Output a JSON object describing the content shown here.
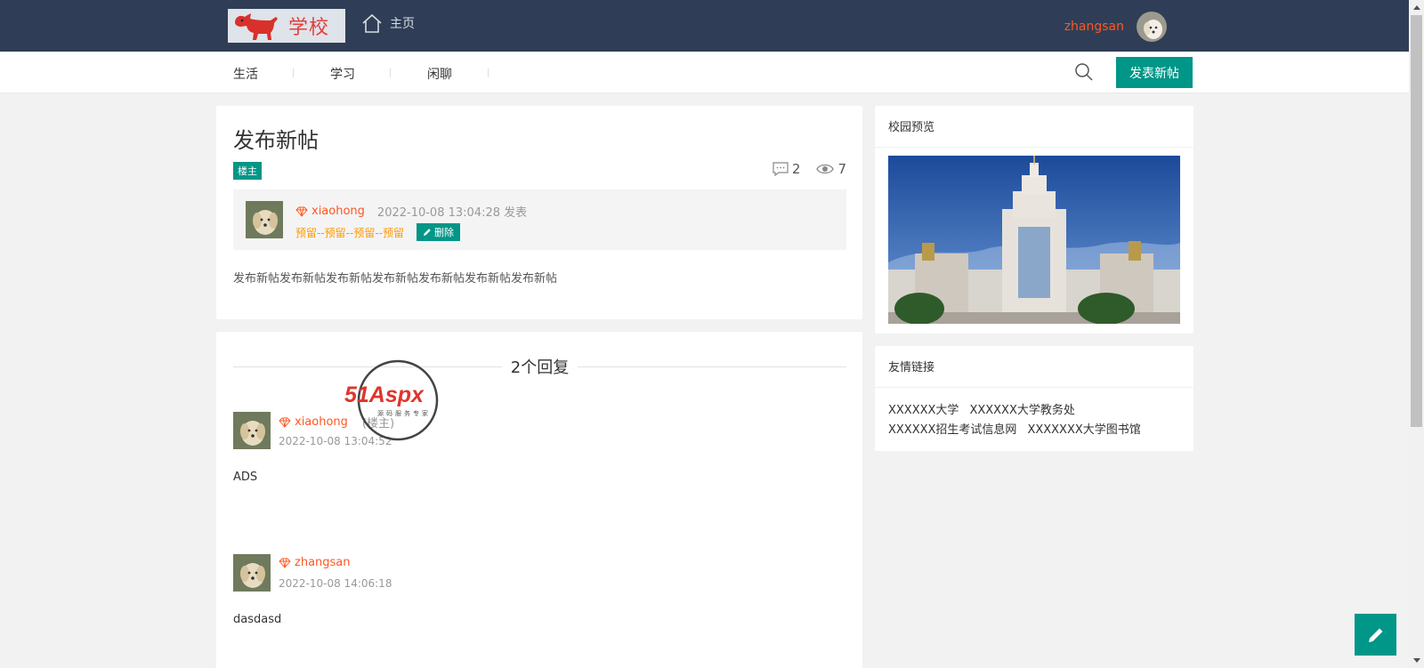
{
  "header": {
    "logo_text": "学校",
    "home_label": "主页",
    "user_name": "zhangsan",
    "icons": {
      "logo": "dog-logo-icon",
      "home": "home-icon",
      "avatar": "user-avatar-image"
    }
  },
  "subnav": {
    "items": [
      {
        "label": "生活"
      },
      {
        "label": "学习"
      },
      {
        "label": "闲聊"
      }
    ],
    "search_icon": "search-icon",
    "post_button_label": "发表新帖"
  },
  "post": {
    "title": "发布新帖",
    "tag": "楼主",
    "comment_count": "2",
    "view_count": "7",
    "author": "xiaohong",
    "time": "2022-10-08 13:04:28 发表",
    "reserve_text": "预留--预留--预留--预留",
    "delete_label": "删除",
    "body": "发布新帖发布新帖发布新帖发布新帖发布新帖发布新帖发布新帖"
  },
  "replies": {
    "heading": "2个回复",
    "items": [
      {
        "author": "xiaohong",
        "owner_note": "(楼主)",
        "time": "2022-10-08 13:04:52",
        "content": "ADS"
      },
      {
        "author": "zhangsan",
        "time": "2022-10-08 14:06:18",
        "content": "dasdasd"
      }
    ]
  },
  "sidebar": {
    "preview_title": "校园预览",
    "links_title": "友情链接",
    "links": [
      {
        "label": "XXXXXX大学"
      },
      {
        "label": "XXXXXX大学教务处"
      },
      {
        "label": "XXXXXX招生考试信息网"
      },
      {
        "label": "XXXXXXX大学图书馆"
      }
    ]
  },
  "watermark": {
    "brand": "51Aspx",
    "slogan": "源码服务专家"
  },
  "colors": {
    "header_bg": "#2f3e56",
    "accent": "#009688",
    "username": "#ff5722",
    "reserve": "#ff9800"
  }
}
